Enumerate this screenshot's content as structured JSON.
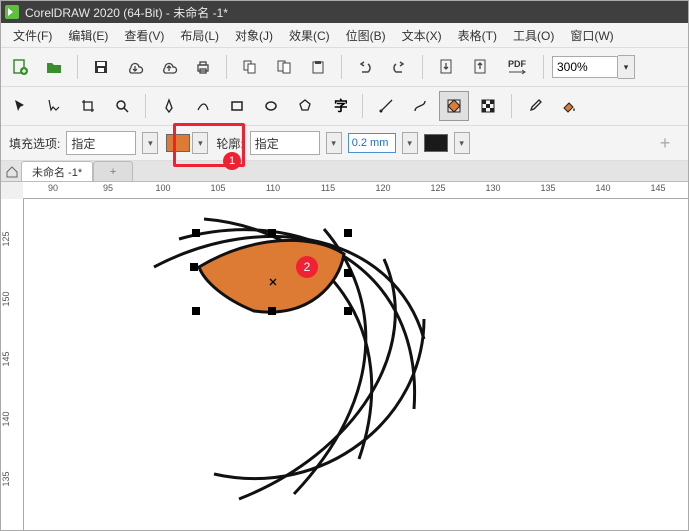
{
  "title": "CorelDRAW 2020 (64-Bit) - 未命名 -1*",
  "menu": {
    "file": "文件(F)",
    "edit": "编辑(E)",
    "view": "查看(V)",
    "layout": "布局(L)",
    "object": "对象(J)",
    "effect": "效果(C)",
    "bitmap": "位图(B)",
    "text": "文本(X)",
    "table": "表格(T)",
    "tool": "工具(O)",
    "window": "窗口(W)"
  },
  "zoom": "300%",
  "attr": {
    "fill_label": "填充选项:",
    "fill_mode": "指定",
    "outline_label": "轮廓:",
    "outline_mode": "指定",
    "outline_width": "0.2 mm",
    "fill_color": "#dd7a33",
    "outline_color": "#1a1a1a"
  },
  "tab": {
    "name": "未命名 -1*",
    "plus": "+"
  },
  "ruler_h": [
    "90",
    "95",
    "100",
    "105",
    "110",
    "115",
    "120",
    "125",
    "130",
    "135",
    "140",
    "145"
  ],
  "ruler_v": [
    "125",
    "150",
    "145",
    "140",
    "135"
  ],
  "callout": {
    "c1": "1",
    "c2": "2"
  }
}
